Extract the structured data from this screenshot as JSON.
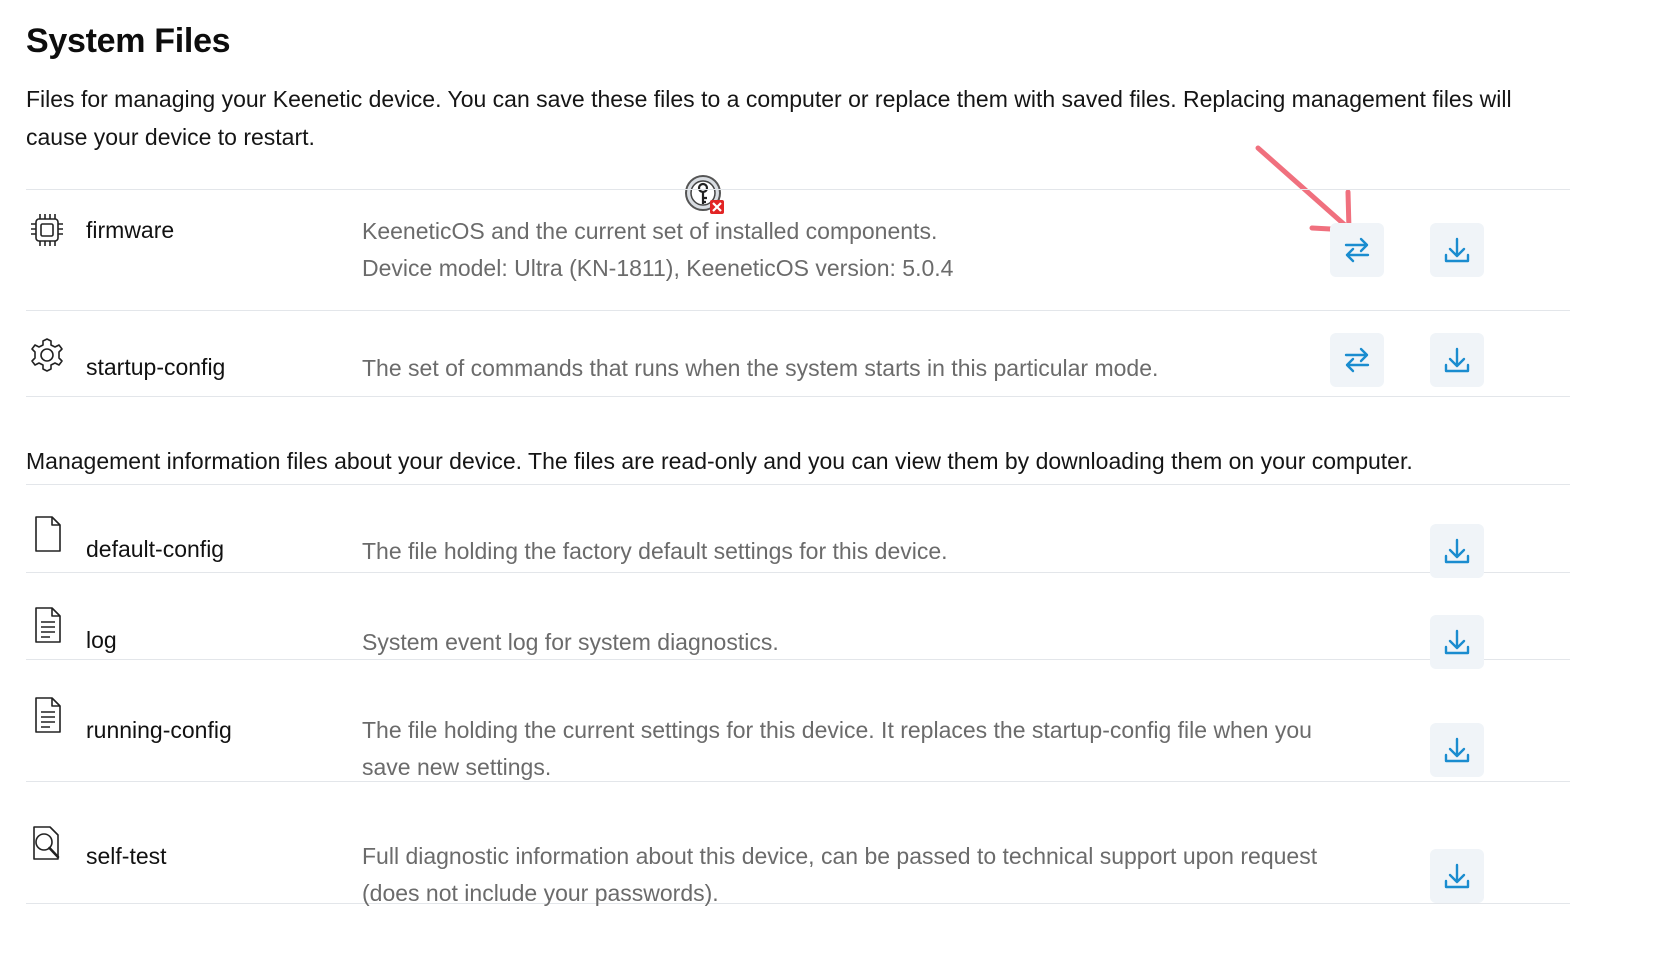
{
  "header": {
    "title": "System Files",
    "intro": "Files for managing your Keenetic device. You can save these files to a computer or replace them with saved files. Replacing management files will cause your device to restart."
  },
  "management_files": [
    {
      "name": "firmware",
      "icon": "chip-icon",
      "desc_lines": [
        "KeeneticOS and the current set of installed components.",
        "Device model: Ultra (KN-1811), KeeneticOS version: 5.0.4"
      ],
      "actions": [
        "replace",
        "download"
      ]
    },
    {
      "name": "startup-config",
      "icon": "gear-icon",
      "desc_lines": [
        "The set of commands that runs when the system starts in this particular mode."
      ],
      "actions": [
        "replace",
        "download"
      ]
    }
  ],
  "info_section": {
    "text": "Management information files about your device. The files are read-only and you can view them by downloading them on your computer."
  },
  "info_files": [
    {
      "name": "default-config",
      "icon": "blank-file-icon",
      "desc_lines": [
        "The file holding the factory default settings for this device."
      ],
      "actions": [
        "download"
      ]
    },
    {
      "name": "log",
      "icon": "text-file-icon",
      "desc_lines": [
        "System event log for system diagnostics."
      ],
      "actions": [
        "download"
      ]
    },
    {
      "name": "running-config",
      "icon": "text-file-icon",
      "desc_lines": [
        "The file holding the current settings for this device. It replaces the startup-config file when you",
        "save new settings."
      ],
      "actions": [
        "download"
      ]
    },
    {
      "name": "self-test",
      "icon": "magnifier-file-icon",
      "desc_lines": [
        "Full diagnostic information about this device, can be passed to technical support upon request",
        "(does not include your passwords)."
      ],
      "actions": [
        "download"
      ]
    }
  ],
  "colors": {
    "accent": "#1a8ccf",
    "button_bg": "#f0f4f8",
    "annotation_arrow": "#f0707e"
  },
  "overlays": {
    "key_icon": "key-error-icon",
    "arrow_icon": "annotation-arrow-icon"
  }
}
